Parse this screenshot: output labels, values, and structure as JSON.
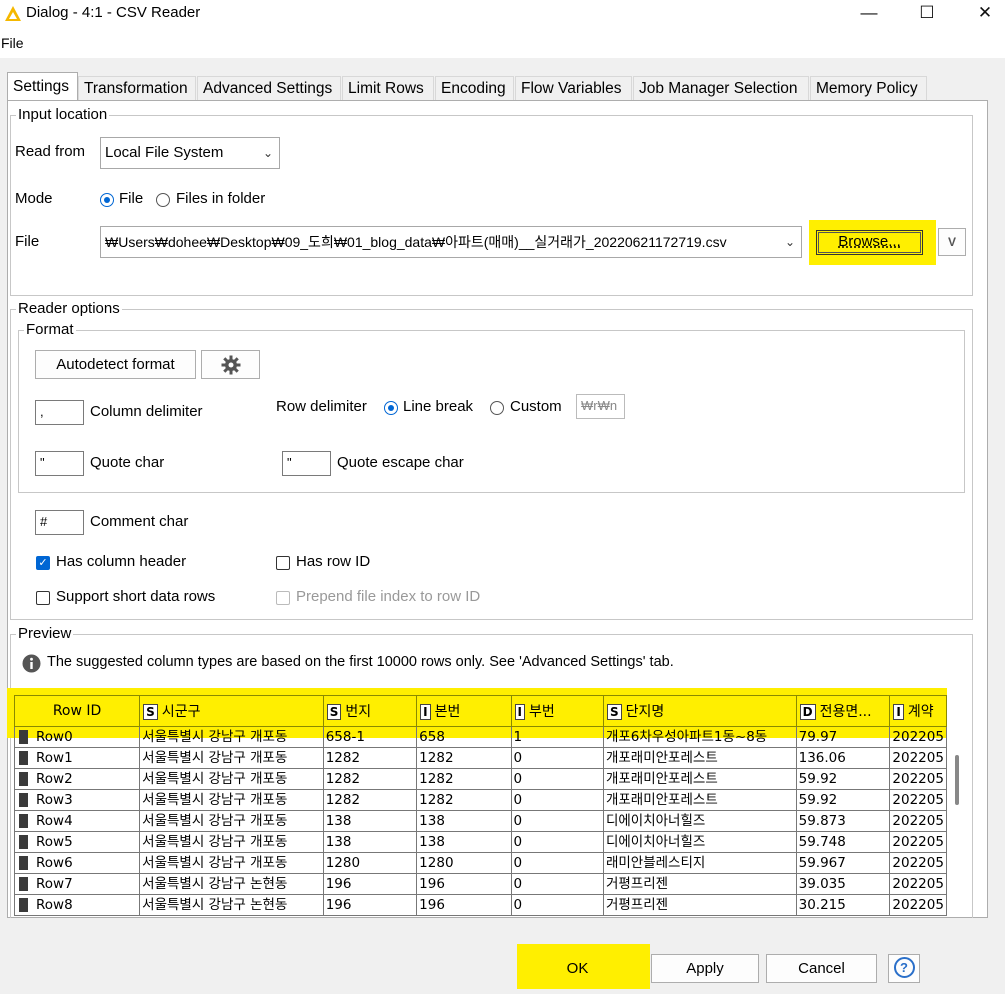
{
  "window": {
    "title": "Dialog - 4:1 - CSV Reader",
    "minimize": "—",
    "maximize": "☐",
    "close": "✕"
  },
  "menu": {
    "file": "File"
  },
  "tabs": [
    "Settings",
    "Transformation",
    "Advanced Settings",
    "Limit Rows",
    "Encoding",
    "Flow Variables",
    "Job Manager Selection",
    "Memory Policy"
  ],
  "input_location": {
    "legend": "Input location",
    "read_from_label": "Read from",
    "read_from_value": "Local File System",
    "mode_label": "Mode",
    "mode_file": "File",
    "mode_files_in_folder": "Files in folder",
    "file_label": "File",
    "file_path": "₩Users₩dohee₩Desktop₩09_도희₩01_blog_data₩아파트(매매)__실거래가_20220621172719.csv",
    "browse": "Browse...",
    "flow_var_icon": "V"
  },
  "reader_options": {
    "legend": "Reader options",
    "format_legend": "Format",
    "autodetect": "Autodetect format",
    "column_delimiter_label": "Column delimiter",
    "column_delimiter_value": ",",
    "row_delimiter_label": "Row delimiter",
    "line_break": "Line break",
    "custom": "Custom",
    "custom_value": "₩r₩n",
    "quote_char_label": "Quote char",
    "quote_char_value": "\"",
    "quote_escape_label": "Quote escape char",
    "quote_escape_value": "\"",
    "comment_char_label": "Comment char",
    "comment_char_value": "#",
    "has_column_header": "Has column header",
    "has_row_id": "Has row ID",
    "support_short_rows": "Support short data rows",
    "prepend_file_index": "Prepend file index to row ID"
  },
  "preview": {
    "legend": "Preview",
    "info": "The suggested column types are based on the first 10000 rows only. See 'Advanced Settings' tab.",
    "columns": [
      {
        "type": "",
        "name": "Row ID"
      },
      {
        "type": "S",
        "name": "시군구"
      },
      {
        "type": "S",
        "name": "번지"
      },
      {
        "type": "I",
        "name": "본번"
      },
      {
        "type": "I",
        "name": "부번"
      },
      {
        "type": "S",
        "name": "단지명"
      },
      {
        "type": "D",
        "name": "전용면..."
      },
      {
        "type": "I",
        "name": "계약"
      }
    ],
    "rows": [
      [
        "Row0",
        "서울특별시 강남구 개포동",
        "658-1",
        "658",
        "1",
        "개포6차우성아파트1동~8동",
        "79.97",
        "202205"
      ],
      [
        "Row1",
        "서울특별시 강남구 개포동",
        "1282",
        "1282",
        "0",
        "개포래미안포레스트",
        "136.06",
        "202205"
      ],
      [
        "Row2",
        "서울특별시 강남구 개포동",
        "1282",
        "1282",
        "0",
        "개포래미안포레스트",
        "59.92",
        "202205"
      ],
      [
        "Row3",
        "서울특별시 강남구 개포동",
        "1282",
        "1282",
        "0",
        "개포래미안포레스트",
        "59.92",
        "202205"
      ],
      [
        "Row4",
        "서울특별시 강남구 개포동",
        "138",
        "138",
        "0",
        "디에이치아너힐즈",
        "59.873",
        "202205"
      ],
      [
        "Row5",
        "서울특별시 강남구 개포동",
        "138",
        "138",
        "0",
        "디에이치아너힐즈",
        "59.748",
        "202205"
      ],
      [
        "Row6",
        "서울특별시 강남구 개포동",
        "1280",
        "1280",
        "0",
        "래미안블레스티지",
        "59.967",
        "202205"
      ],
      [
        "Row7",
        "서울특별시 강남구 논현동",
        "196",
        "196",
        "0",
        "거평프리젠",
        "39.035",
        "202205"
      ],
      [
        "Row8",
        "서울특별시 강남구 논현동",
        "196",
        "196",
        "0",
        "거평프리젠",
        "30.215",
        "202205"
      ]
    ]
  },
  "buttons": {
    "ok": "OK",
    "apply": "Apply",
    "cancel": "Cancel",
    "help": "?"
  },
  "colors": {
    "highlight": "#ffef00",
    "accent": "#0066d4"
  }
}
